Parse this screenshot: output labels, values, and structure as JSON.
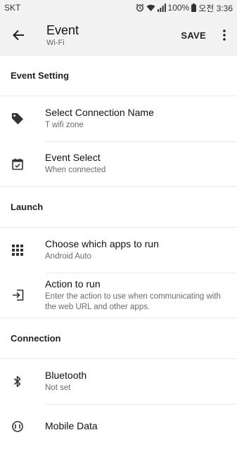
{
  "status_bar": {
    "carrier": "SKT",
    "battery": "100%",
    "time": "오전 3:36"
  },
  "app_bar": {
    "title": "Event",
    "subtitle": "Wi-Fi",
    "save_label": "SAVE"
  },
  "sections": {
    "event_setting": {
      "header": "Event Setting",
      "items": [
        {
          "title": "Select Connection Name",
          "subtitle": "T wifi zone",
          "icon": "tag-icon"
        },
        {
          "title": "Event Select",
          "subtitle": "When connected",
          "icon": "calendar-check-icon"
        }
      ]
    },
    "launch": {
      "header": "Launch",
      "items": [
        {
          "title": "Choose which apps to run",
          "subtitle": "Android Auto",
          "icon": "apps-grid-icon"
        },
        {
          "title": "Action to run",
          "subtitle": "Enter the action to use when communicating with the web URL and other apps.",
          "icon": "input-arrow-icon"
        }
      ]
    },
    "connection": {
      "header": "Connection",
      "items": [
        {
          "title": "Bluetooth",
          "subtitle": "Not set",
          "icon": "bluetooth-icon"
        },
        {
          "title": "Mobile Data",
          "subtitle": "",
          "icon": "mobile-data-icon"
        }
      ]
    }
  }
}
